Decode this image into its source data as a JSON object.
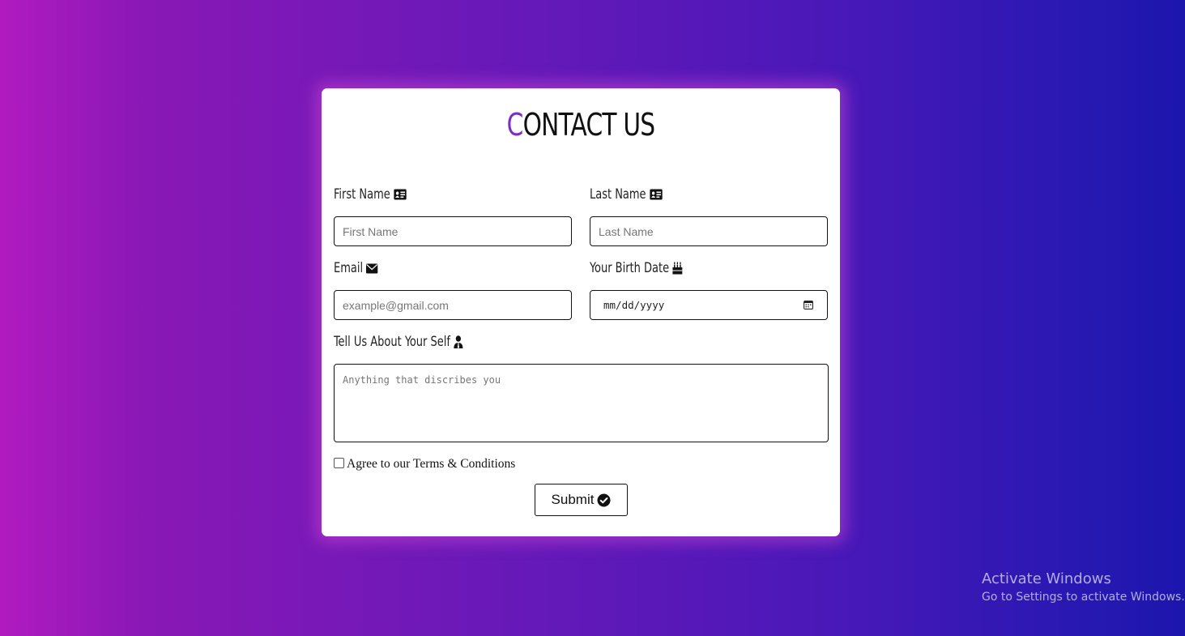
{
  "form": {
    "title_first": "C",
    "title_rest": "ONTACT US",
    "first_name": {
      "label": "First Name",
      "placeholder": "First Name",
      "icon": "id-card-icon"
    },
    "last_name": {
      "label": "Last Name",
      "placeholder": "Last Name",
      "icon": "id-card-icon"
    },
    "email": {
      "label": "Email",
      "placeholder": "example@gmail.com",
      "icon": "envelope-icon"
    },
    "birth_date": {
      "label": "Your Birth Date",
      "placeholder": "mm/dd/yyyy",
      "icon": "birthday-cake-icon"
    },
    "about": {
      "label": "Tell Us About Your Self",
      "placeholder": "Anything that discribes you",
      "icon": "user-tie-icon"
    },
    "terms_label": "Agree to our Terms & Conditions",
    "submit_label": "Submit",
    "accent_color": "#7b2ec4"
  },
  "watermark": {
    "title": "Activate Windows",
    "subtitle": "Go to Settings to activate Windows."
  }
}
